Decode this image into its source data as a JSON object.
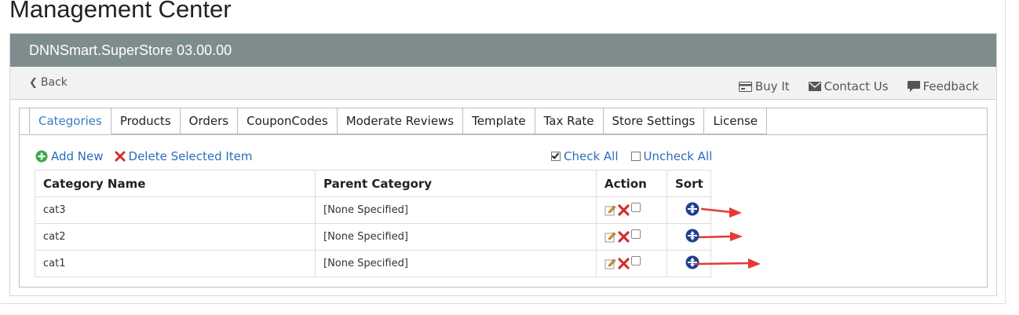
{
  "page": {
    "title": "Management Center"
  },
  "module": {
    "header": "DNNSmart.SuperStore 03.00.00",
    "back_label": "Back",
    "tool_links": [
      {
        "label": "Buy It",
        "icon": "card-icon"
      },
      {
        "label": "Contact Us",
        "icon": "mail-icon"
      },
      {
        "label": "Feedback",
        "icon": "comment-icon"
      }
    ]
  },
  "tabs": [
    {
      "label": "Categories",
      "active": true
    },
    {
      "label": "Products"
    },
    {
      "label": "Orders"
    },
    {
      "label": "CouponCodes"
    },
    {
      "label": "Moderate Reviews"
    },
    {
      "label": "Template"
    },
    {
      "label": "Tax Rate"
    },
    {
      "label": "Store Settings"
    },
    {
      "label": "License"
    }
  ],
  "actions": {
    "add_new": "Add New",
    "delete_selected": "Delete Selected Item",
    "check_all": "Check All",
    "uncheck_all": "Uncheck All"
  },
  "table": {
    "columns": [
      "Category Name",
      "Parent Category",
      "Action",
      "Sort"
    ],
    "rows": [
      {
        "name": "cat3",
        "parent": "[None Specified]"
      },
      {
        "name": "cat2",
        "parent": "[None Specified]"
      },
      {
        "name": "cat1",
        "parent": "[None Specified]"
      }
    ]
  },
  "colors": {
    "header_bg": "#7f8c8d",
    "link": "#2a6ebb",
    "arrow": "#e53935"
  }
}
